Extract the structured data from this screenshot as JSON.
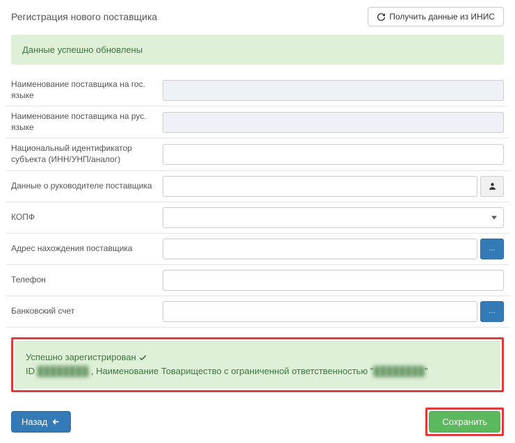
{
  "header": {
    "title": "Регистрация нового поставщика",
    "inis_button": "Получить данные из ИНИС"
  },
  "alert": {
    "updated": "Данные успешно обновлены"
  },
  "form": {
    "name_gov": {
      "label": "Наименование поставщика на гос. языке",
      "value": ""
    },
    "name_rus": {
      "label": "Наименование поставщика на рус. языке",
      "value": ""
    },
    "national_id": {
      "label": "Национальный идентификатор субъекта (ИНН/УНП/аналог)",
      "value": ""
    },
    "manager": {
      "label": "Данные о руководителе поставщика",
      "value": ""
    },
    "kopf": {
      "label": "КОПФ",
      "value": ""
    },
    "address": {
      "label": "Адрес нахождения поставщика",
      "value": ""
    },
    "phone": {
      "label": "Телефон",
      "value": ""
    },
    "bank": {
      "label": "Банковский счет",
      "value": ""
    }
  },
  "result": {
    "line1_prefix": "Успешно зарегистрирован",
    "line2_id_prefix": "ID ",
    "line2_id_value": "████████",
    "line2_mid": " , Наименование Товарищество с ограниченной ответственностью \"",
    "line2_name_value": "████████",
    "line2_suffix": "\""
  },
  "footer": {
    "back": "Назад",
    "save": "Сохранить"
  }
}
